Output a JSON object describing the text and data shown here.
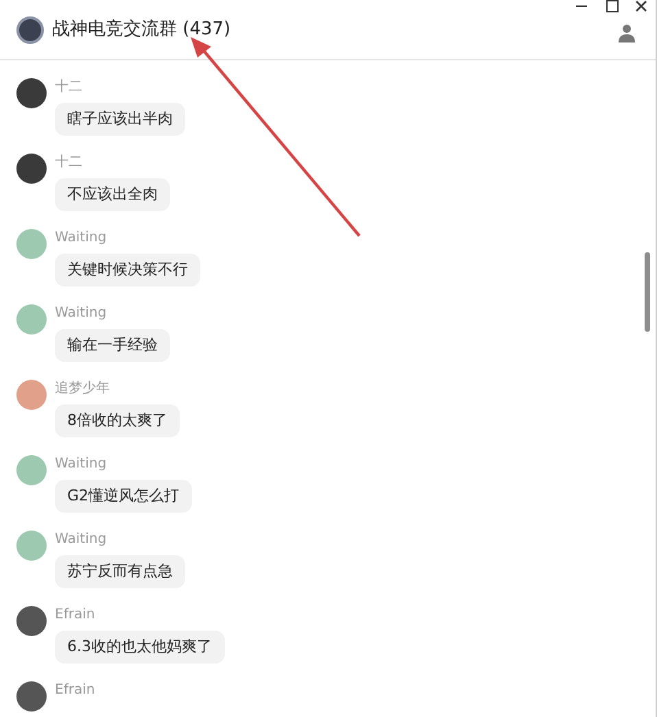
{
  "window": {
    "title": "战神电竞交流群 (437)"
  },
  "messages": [
    {
      "sender": "十二",
      "color": "#3a3a3a",
      "text": "瞎子应该出半肉"
    },
    {
      "sender": "十二",
      "color": "#3a3a3a",
      "text": "不应该出全肉"
    },
    {
      "sender": "Waiting",
      "color": "#9cc9b0",
      "text": "关键时候决策不行"
    },
    {
      "sender": "Waiting",
      "color": "#9cc9b0",
      "text": "输在一手经验"
    },
    {
      "sender": "追梦少年",
      "color": "#e0a08a",
      "text": "8倍收的太爽了"
    },
    {
      "sender": "Waiting",
      "color": "#9cc9b0",
      "text": "G2懂逆风怎么打"
    },
    {
      "sender": "Waiting",
      "color": "#9cc9b0",
      "text": "苏宁反而有点急"
    },
    {
      "sender": "Efrain",
      "color": "#555555",
      "text": "6.3收的也太他妈爽了"
    },
    {
      "sender": "Efrain",
      "color": "#555555"
    }
  ]
}
